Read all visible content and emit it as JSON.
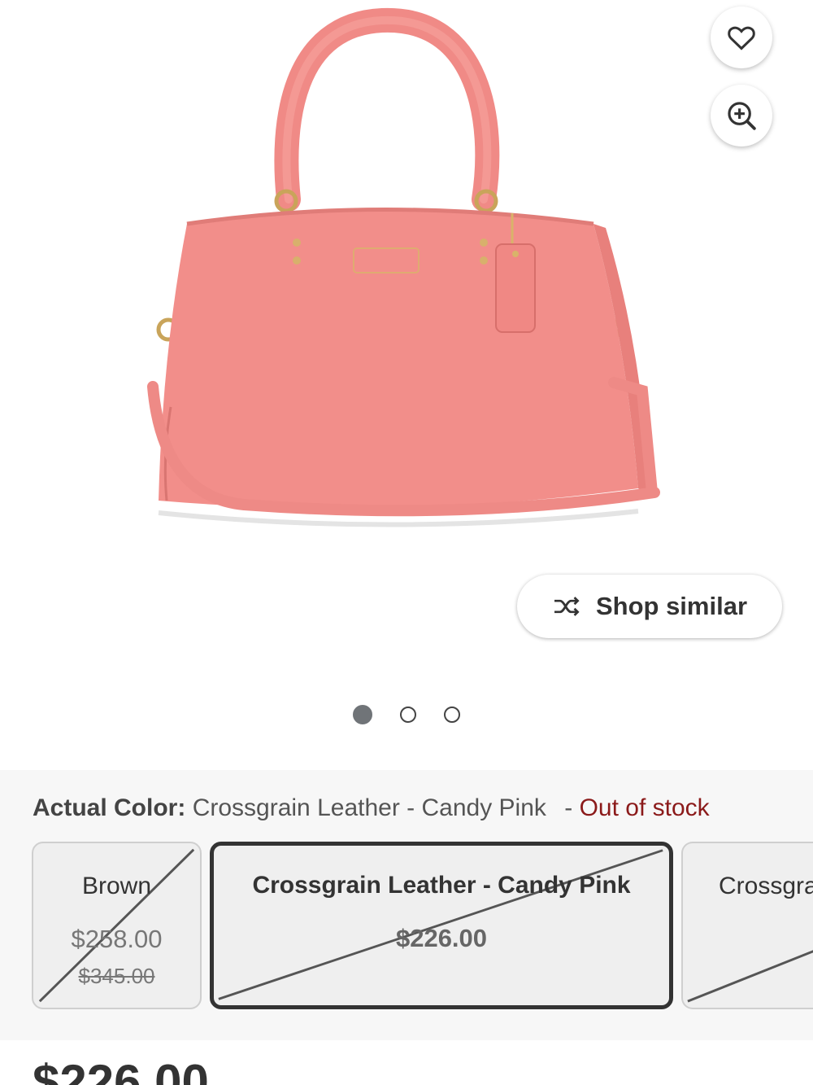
{
  "actions": {
    "shop_similar_label": "Shop similar",
    "favorite_icon": "heart-icon",
    "zoom_icon": "zoom-in-icon",
    "shuffle_icon": "shuffle-icon"
  },
  "carousel": {
    "total": 3,
    "active_index": 0
  },
  "color": {
    "label": "Actual Color:",
    "value": "Crossgrain Leather - Candy Pink",
    "separator": "-",
    "status": "Out of stock",
    "status_color": "#8b1a1a",
    "swatches": [
      {
        "name": "Brown",
        "price": "$258.00",
        "was": "$345.00",
        "unavailable": true
      },
      {
        "name": "Crossgrain Leather - Candy Pink",
        "price": "$226.00",
        "selected": true,
        "unavailable": true
      },
      {
        "name": "Crossgra",
        "unavailable": true
      }
    ]
  },
  "product": {
    "image_alt": "Pink leather satchel handbag",
    "bag_color": "#f28e8a",
    "price": "$226.00"
  }
}
